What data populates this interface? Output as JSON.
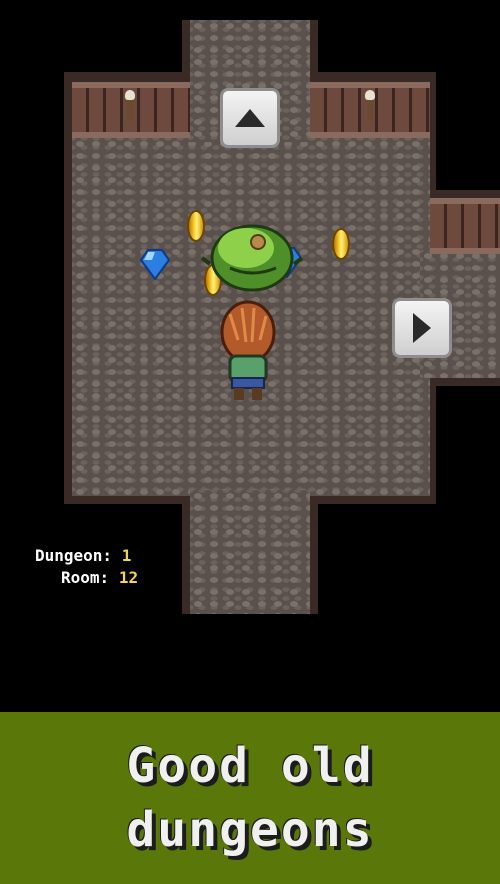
{
  "hud": {
    "dungeon_label": "Dungeon:",
    "dungeon_value": "1",
    "room_label": "Room:",
    "room_value": "12"
  },
  "controls": {
    "up_icon": "triangle-up-icon",
    "right_icon": "triangle-right-icon"
  },
  "banner": {
    "line1": "Good old",
    "line2": "dungeons",
    "background": "#5a780a"
  },
  "entities": {
    "monster": "green-slime",
    "hero": "red-haired-hero",
    "coins": 3,
    "gems": 2
  }
}
